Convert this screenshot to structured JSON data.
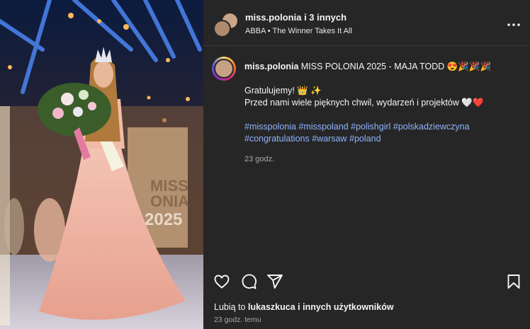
{
  "post": {
    "header": {
      "author": "miss.polonia",
      "coauthors": " i 3 innych",
      "music": "ABBA • The Winner Takes It All"
    },
    "caption": {
      "author": "miss.polonia",
      "title": "MISS POLONIA 2025 - MAJA TODD 😍🎉🎉🎉",
      "line1": "Gratulujemy! 👑 ✨",
      "line2": "Przed nami wiele pięknych chwil, wydarzeń i projektów 🤍❤️",
      "hashtags": [
        "#misspolonia",
        "#misspoland",
        "#polishgirl",
        "#polskadziewczyna",
        "#congratulations",
        "#warsaw",
        "#poland"
      ],
      "time": "23 godz."
    },
    "likes": {
      "prefix": "Lubią to ",
      "user": "lukaszkuca",
      "suffix": " i innych użytkowników"
    },
    "posted_ago": "23 godz. temu",
    "photo": {
      "backdrop_text": "MISS",
      "backdrop_text2": "ONIA",
      "backdrop_year": "2025"
    }
  },
  "icons": [
    "more-icon",
    "heart-icon",
    "comment-icon",
    "share-icon",
    "bookmark-icon"
  ],
  "colors": {
    "background": "#262626",
    "hashtag": "#8fb4ff",
    "muted": "#a8a8a8"
  }
}
